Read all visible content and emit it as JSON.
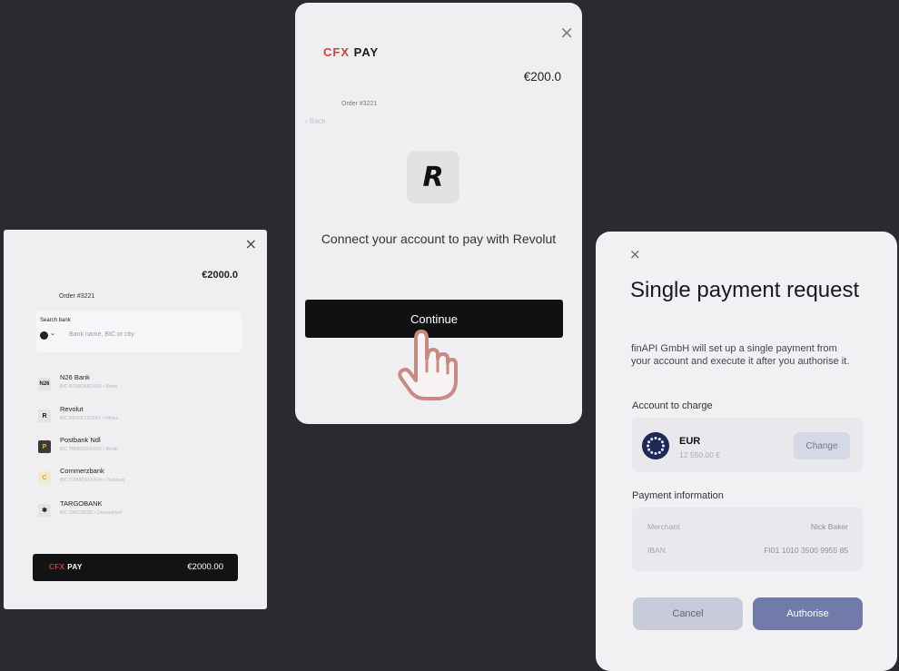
{
  "left_card": {
    "close": "×",
    "amount": "€2000.0",
    "order": "Order #3221",
    "search_label": "Search bank",
    "search_chevron": "⌄",
    "search_placeholder": "Bank name, BIC or city",
    "banks": [
      {
        "icon_text": "N26",
        "name": "N26 Bank",
        "sub": "BIC NTSBDEB1XXX • Berlin",
        "icon_color": "#1a1a1a",
        "icon_bg": "#e4e4e6"
      },
      {
        "icon_text": "R",
        "name": "Revolut",
        "sub": "BIC REVOLT21XXX • Vilnius",
        "icon_color": "#1a1a1a",
        "icon_bg": "#e4e4e6"
      },
      {
        "icon_text": "P",
        "name": "Postbank Ndl",
        "sub": "BIC PBNKDEFFXXX • Berlin",
        "icon_color": "#f5c400",
        "icon_bg": "#3a3a3a"
      },
      {
        "icon_text": "C",
        "name": "Commerzbank",
        "sub": "BIC COBADEFFXXX • Duisburg",
        "icon_color": "#e0a700",
        "icon_bg": "#f1ead0"
      },
      {
        "icon_text": "✱",
        "name": "TARGOBANK",
        "sub": "BIC CMCIDEDD • Duesseldorf",
        "icon_color": "#222",
        "icon_bg": "#e4e4e6"
      }
    ],
    "pay_logo_a": "CFX",
    "pay_logo_b": " PAY",
    "pay_amount": "€2000.00"
  },
  "middle_card": {
    "close": "×",
    "logo_a": "CFX",
    "logo_b": " PAY",
    "amount": "€200.0",
    "order": "Order #3221",
    "back": "‹  Back",
    "revolut_icon_text": "R",
    "message": "Connect your account to pay with Revolut",
    "continue_label": "Continue"
  },
  "right_card": {
    "close": "×",
    "title": "Single payment request",
    "description": "finAPI GmbH will set up a single payment from your account and execute it after you authorise it.",
    "account_label": "Account to charge",
    "account_currency": "EUR",
    "account_balance": "12 550,00 €",
    "change_label": "Change",
    "payment_label": "Payment information",
    "payment_rows": [
      {
        "key": "Merchant",
        "value": "Nick Baker"
      },
      {
        "key": "IBAN",
        "value": "FI01 1010 3500 9955 85"
      }
    ],
    "cancel_label": "Cancel",
    "authorise_label": "Authorise"
  },
  "colors": {
    "background": "#2a2b2f",
    "brand_red": "#d14040",
    "accent": "#717aa8",
    "hand_outline": "#c98a84"
  }
}
